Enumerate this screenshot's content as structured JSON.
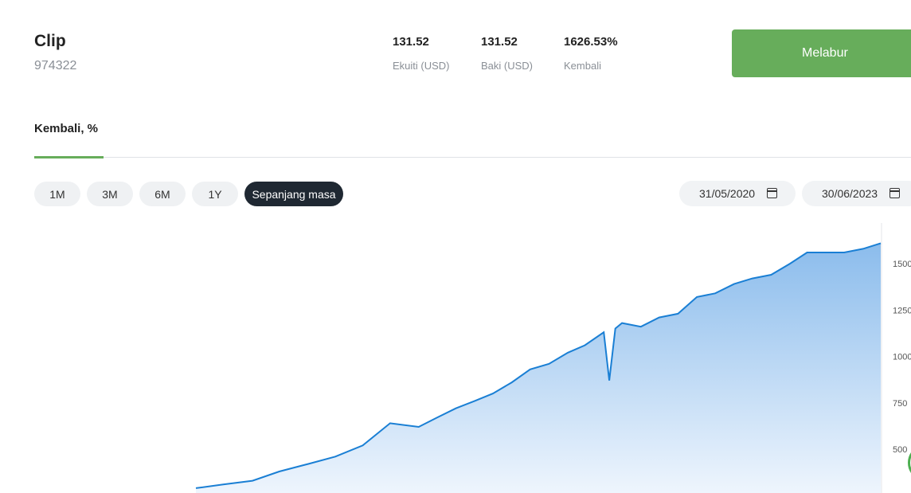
{
  "account": {
    "name": "Clip",
    "id": "974322"
  },
  "stats": [
    {
      "value": "131.52",
      "label": "Ekuiti (USD)"
    },
    {
      "value": "131.52",
      "label": "Baki (USD)"
    },
    {
      "value": "1626.53%",
      "label": "Kembali"
    }
  ],
  "invest_label": "Melabur",
  "tab_label": "Kembali, %",
  "ranges": [
    "1M",
    "3M",
    "6M",
    "1Y",
    "Sepanjang masa"
  ],
  "active_range": "Sepanjang masa",
  "dates": {
    "from": "31/05/2020",
    "to": "30/06/2023"
  },
  "colors": {
    "line": "#1a7fd4",
    "accent": "#67ad5b",
    "area_top": "#8bbcec",
    "area_bottom": "#eef5fd"
  },
  "chart_data": {
    "type": "area",
    "ylim": [
      0,
      1650
    ],
    "yticks": [
      {
        "value": 500,
        "label": "500"
      },
      {
        "value": 750,
        "label": "750"
      },
      {
        "value": 1000,
        "label": "1000"
      },
      {
        "value": 1250,
        "label": "1250"
      },
      {
        "value": 1500,
        "label": "1500"
      }
    ],
    "xlim": [
      "2020-05-31",
      "2023-06-30"
    ],
    "grid": false,
    "series": [
      {
        "x": [
          "2020-05-31",
          "2020-07-15",
          "2020-09-01",
          "2020-10-15",
          "2020-12-01",
          "2021-01-15",
          "2021-03-01",
          "2021-04-15",
          "2021-06-01",
          "2021-07-01",
          "2021-08-01",
          "2021-09-01",
          "2021-10-01",
          "2021-11-01",
          "2021-12-01",
          "2022-01-01",
          "2022-02-01",
          "2022-03-01",
          "2022-04-01",
          "2022-04-10",
          "2022-04-20",
          "2022-05-01",
          "2022-06-01",
          "2022-07-01",
          "2022-08-01",
          "2022-09-01",
          "2022-10-01",
          "2022-11-01",
          "2022-12-01",
          "2023-01-01",
          "2023-02-01",
          "2023-03-01",
          "2023-04-01",
          "2023-05-01",
          "2023-06-01",
          "2023-06-30"
        ],
        "y": [
          290,
          310,
          330,
          380,
          420,
          460,
          520,
          640,
          620,
          670,
          720,
          760,
          800,
          860,
          930,
          960,
          1020,
          1060,
          1130,
          870,
          1150,
          1180,
          1160,
          1210,
          1230,
          1320,
          1340,
          1390,
          1420,
          1440,
          1500,
          1560,
          1560,
          1560,
          1580,
          1610
        ]
      }
    ]
  }
}
